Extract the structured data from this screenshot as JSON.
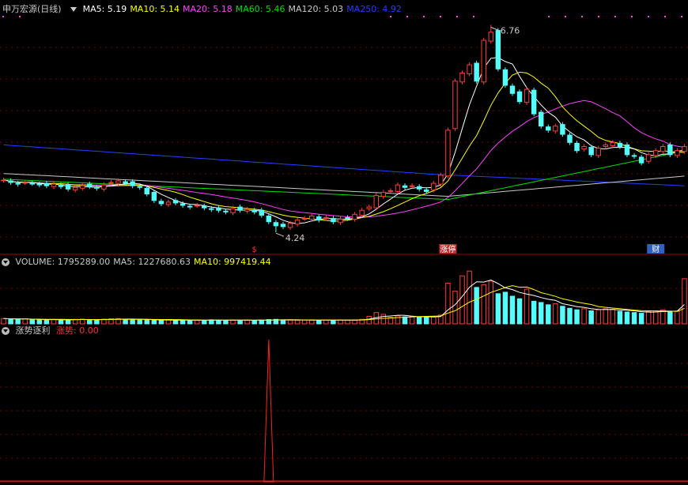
{
  "colors": {
    "up": "#ff3c3c",
    "down": "#54fcfc",
    "ma5": "#ffffff",
    "ma10": "#ffff00",
    "ma20": "#ff40ff",
    "ma60": "#00e000",
    "ma120": "#c8c8c8",
    "ma250": "#2040ff",
    "grid": "#7a0000",
    "divider": "#a00000",
    "signal": "#ff2020"
  },
  "price_panel": {
    "title": "申万宏源(日线)",
    "legend": [
      {
        "label": "MA5: ",
        "value": "5.19",
        "color": "#ffffff"
      },
      {
        "label": "MA10: ",
        "value": "5.14",
        "color": "#ffff00"
      },
      {
        "label": "MA20: ",
        "value": "5.18",
        "color": "#ff40ff"
      },
      {
        "label": "MA60: ",
        "value": "5.46",
        "color": "#00e000"
      },
      {
        "label": "MA120: ",
        "value": "5.03",
        "color": "#c8c8c8"
      },
      {
        "label": "MA250: ",
        "value": "4.92",
        "color": "#2040ff"
      }
    ],
    "high_label": "6.76",
    "low_label": "4.24",
    "markers": [
      {
        "text": "$",
        "color": "#ff3030",
        "bg": "transparent"
      },
      {
        "text": "涨停",
        "color": "#ffffff",
        "bg": "#c03030"
      },
      {
        "text": "财",
        "color": "#ffffff",
        "bg": "#3060c0"
      }
    ]
  },
  "volume_panel": {
    "legend": [
      {
        "label": "VOLUME: ",
        "value": "1795289.00",
        "color": "#c8c8c8"
      },
      {
        "label": "MA5: ",
        "value": "1227680.63",
        "color": "#c8c8c8"
      },
      {
        "label": "MA10: ",
        "value": "997419.44",
        "color": "#ffff00"
      }
    ]
  },
  "indicator_panel": {
    "title": "涨势逐利",
    "legend": [
      {
        "label": "涨势: ",
        "value": "0.00",
        "color": "#ff3030"
      }
    ]
  },
  "chart_data": [
    {
      "type": "candlestick",
      "title": "申万宏源(日线)",
      "ylim": [
        4.0,
        6.9
      ],
      "high": 6.76,
      "low": 4.24,
      "x_count": 96,
      "close": [
        4.89,
        4.86,
        4.84,
        4.86,
        4.85,
        4.83,
        4.82,
        4.84,
        4.81,
        4.78,
        4.8,
        4.82,
        4.81,
        4.79,
        4.83,
        4.86,
        4.88,
        4.85,
        4.82,
        4.8,
        4.72,
        4.64,
        4.6,
        4.62,
        4.61,
        4.58,
        4.56,
        4.58,
        4.55,
        4.53,
        4.52,
        4.5,
        4.54,
        4.52,
        4.53,
        4.5,
        4.46,
        4.38,
        4.33,
        4.32,
        4.36,
        4.4,
        4.42,
        4.45,
        4.4,
        4.43,
        4.38,
        4.41,
        4.42,
        4.47,
        4.52,
        4.56,
        4.7,
        4.74,
        4.76,
        4.83,
        4.8,
        4.82,
        4.78,
        4.75,
        4.85,
        4.95,
        5.5,
        6.1,
        6.2,
        6.3,
        6.1,
        6.6,
        6.7,
        6.25,
        6.05,
        5.95,
        5.85,
        6.0,
        5.7,
        5.55,
        5.5,
        5.55,
        5.45,
        5.35,
        5.25,
        5.3,
        5.2,
        5.28,
        5.32,
        5.35,
        5.3,
        5.2,
        5.18,
        5.1,
        5.2,
        5.25,
        5.3,
        5.2,
        5.25,
        5.3
      ],
      "volume_max": 2200000,
      "volume": [
        210000,
        190000,
        180000,
        200000,
        170000,
        160000,
        150000,
        175000,
        165000,
        155000,
        180000,
        190000,
        170000,
        160000,
        185000,
        200000,
        210000,
        190000,
        170000,
        165000,
        160000,
        150000,
        140000,
        155000,
        145000,
        150000,
        140000,
        150000,
        145000,
        160000,
        150000,
        140000,
        155000,
        145000,
        150000,
        140000,
        150000,
        170000,
        180000,
        160000,
        150000,
        140000,
        150000,
        160000,
        140000,
        150000,
        145000,
        155000,
        150000,
        160000,
        180000,
        300000,
        450000,
        380000,
        260000,
        320000,
        280000,
        300000,
        260000,
        250000,
        280000,
        350000,
        1620000,
        1300000,
        1910000,
        2100000,
        1450000,
        1560000,
        1700000,
        1200000,
        1260000,
        1100000,
        1000000,
        1380000,
        900000,
        850000,
        760000,
        800000,
        700000,
        620000,
        560000,
        600000,
        520000,
        560000,
        600000,
        580000,
        500000,
        470000,
        450000,
        420000,
        500000,
        520000,
        560000,
        470000,
        500000,
        1795289
      ],
      "signal": {
        "name": "涨势",
        "values_nonzero_index": 37,
        "peak": 1.0,
        "last": 0.0
      }
    }
  ]
}
